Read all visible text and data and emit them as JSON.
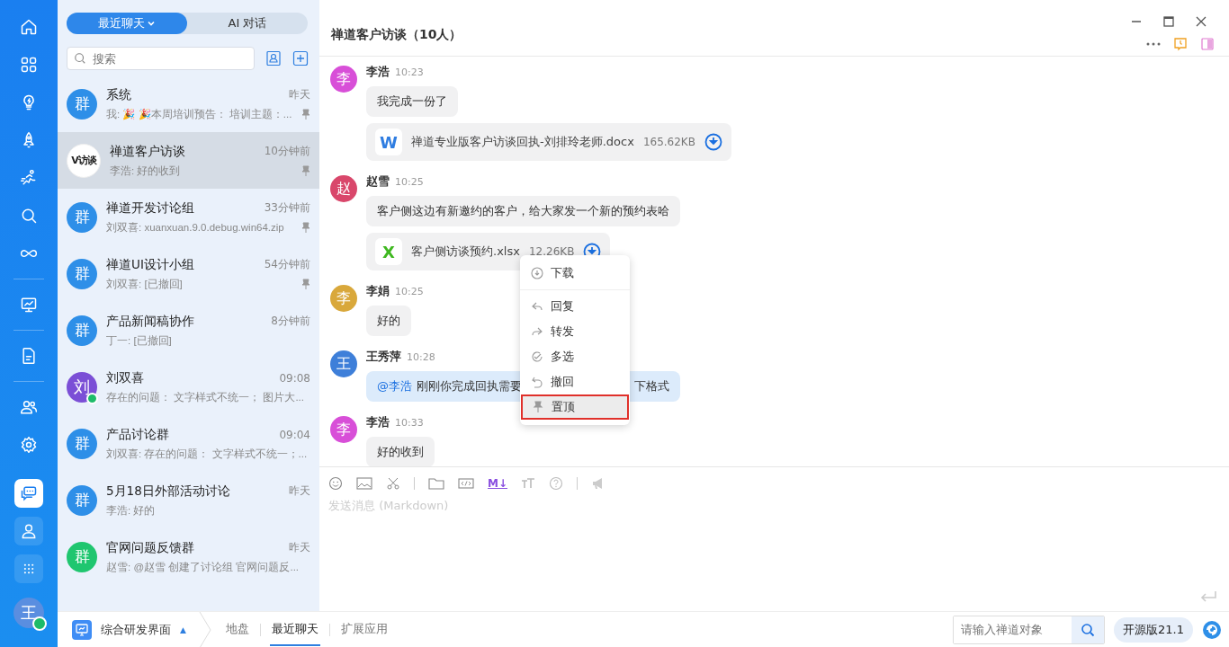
{
  "rail": {
    "items": [
      {
        "selected": false
      },
      {
        "selected": false
      },
      {
        "selected": false
      },
      {
        "selected": false
      },
      {
        "selected": false
      },
      {
        "selected": false
      },
      {
        "selected": false
      },
      {
        "selected": false
      },
      {
        "selected": false
      },
      {
        "selected": false
      },
      {
        "selected": false
      }
    ],
    "apps": [
      {
        "selected": true
      },
      {
        "selected": false
      },
      {
        "selected": false
      }
    ],
    "user": {
      "avatar": "王",
      "online": true
    }
  },
  "list": {
    "tabs": [
      {
        "label": "最近聊天",
        "selected": true,
        "dropdown": true
      },
      {
        "label": "AI 对话",
        "selected": false,
        "dropdown": false
      }
    ],
    "search": {
      "placeholder": "搜索"
    },
    "conversations": [
      {
        "avatar": "群",
        "kind": "group",
        "color": "#2e8fe8",
        "online": false,
        "title": "系统",
        "time": "昨天",
        "preview": "我: 🎉 🎉本周培训预告： 培训主题：...",
        "pinned": true,
        "selected": false
      },
      {
        "avatar": "V访谈",
        "kind": "logo",
        "color": "#ffffff",
        "online": false,
        "title": "禅道客户访谈",
        "time": "10分钟前",
        "preview": "李浩: 好的收到",
        "pinned": true,
        "selected": true
      },
      {
        "avatar": "群",
        "kind": "group",
        "color": "#2e8fe8",
        "online": false,
        "title": "禅道开发讨论组",
        "time": "33分钟前",
        "preview": "刘双喜: xuanxuan.9.0.debug.win64.zip",
        "pinned": true,
        "selected": false
      },
      {
        "avatar": "群",
        "kind": "group",
        "color": "#2e8fe8",
        "online": false,
        "title": "禅道UI设计小组",
        "time": "54分钟前",
        "preview": "刘双喜: [已撤回]",
        "pinned": true,
        "selected": false
      },
      {
        "avatar": "群",
        "kind": "group",
        "color": "#2e8fe8",
        "online": false,
        "title": "产品新闻稿协作",
        "time": "8分钟前",
        "preview": "丁一: [已撤回]",
        "pinned": false,
        "selected": false
      },
      {
        "avatar": "刘",
        "kind": "person",
        "color": "#7b4fd6",
        "online": true,
        "title": "刘双喜",
        "time": "09:08",
        "preview": "存在的问题： 文字样式不统一； 图片大...",
        "pinned": false,
        "selected": false
      },
      {
        "avatar": "群",
        "kind": "group",
        "color": "#2e8fe8",
        "online": false,
        "title": "产品讨论群",
        "time": "09:04",
        "preview": "刘双喜: 存在的问题： 文字样式不统一；...",
        "pinned": false,
        "selected": false
      },
      {
        "avatar": "群",
        "kind": "group",
        "color": "#2e8fe8",
        "online": false,
        "title": "5月18日外部活动讨论",
        "time": "昨天",
        "preview": "李浩: 好的",
        "pinned": false,
        "selected": false
      },
      {
        "avatar": "群",
        "kind": "group",
        "color": "#1fc66f",
        "online": false,
        "title": "官网问题反馈群",
        "time": "昨天",
        "preview": "赵雪: @赵雪 创建了讨论组 官网问题反...",
        "pinned": false,
        "selected": false
      }
    ]
  },
  "chat": {
    "title": "禅道客户访谈（10人）",
    "messages": [
      {
        "sender": "李浩",
        "time": "10:23",
        "avatar": "李",
        "color": "#d84fd8",
        "items": [
          {
            "kind": "text",
            "text": "我完成一份了"
          },
          {
            "kind": "file",
            "letter": "W",
            "color": "#2f7de1",
            "name": "禅道专业版客户访谈回执-刘排玲老师.docx",
            "size": "165.62KB"
          }
        ]
      },
      {
        "sender": "赵雪",
        "time": "10:25",
        "avatar": "赵",
        "color": "#d9476b",
        "items": [
          {
            "kind": "text",
            "text": "客户侧这边有新邀约的客户，给大家发一个新的预约表哈"
          },
          {
            "kind": "file",
            "letter": "X",
            "color": "#3fb820",
            "name": "客户侧访谈预约.xlsx",
            "size": "12.26KB"
          }
        ]
      },
      {
        "sender": "李娟",
        "time": "10:25",
        "avatar": "李",
        "color": "#d9a83b",
        "items": [
          {
            "kind": "text",
            "text": "好的"
          }
        ]
      },
      {
        "sender": "王秀萍",
        "time": "10:28",
        "avatar": "王",
        "color": "#3e7fd9",
        "items": [
          {
            "kind": "mention",
            "mention": "@李浩",
            "text": "刚刚你完成回执需要",
            "tail": "下格式"
          }
        ]
      },
      {
        "sender": "李浩",
        "time": "10:33",
        "avatar": "李",
        "color": "#d84fd8",
        "items": [
          {
            "kind": "text",
            "text": "好的收到"
          }
        ]
      }
    ],
    "menu": [
      {
        "label": "下载",
        "highlighted": false
      },
      {
        "label": "回复",
        "highlighted": false
      },
      {
        "label": "转发",
        "highlighted": false
      },
      {
        "label": "多选",
        "highlighted": false
      },
      {
        "label": "撤回",
        "highlighted": false
      },
      {
        "label": "置顶",
        "highlighted": true
      }
    ],
    "toolbar": {
      "markdown": "M↓"
    },
    "composer": {
      "placeholder": "发送消息 (Markdown)"
    }
  },
  "bottom": {
    "workspace": "综合研发界面",
    "caret": "▲",
    "tabs": [
      {
        "label": "地盘",
        "selected": false
      },
      {
        "label": "最近聊天",
        "selected": true
      },
      {
        "label": "扩展应用",
        "selected": false
      }
    ],
    "search": {
      "placeholder": "请输入禅道对象"
    },
    "edition": "开源版21.1"
  }
}
